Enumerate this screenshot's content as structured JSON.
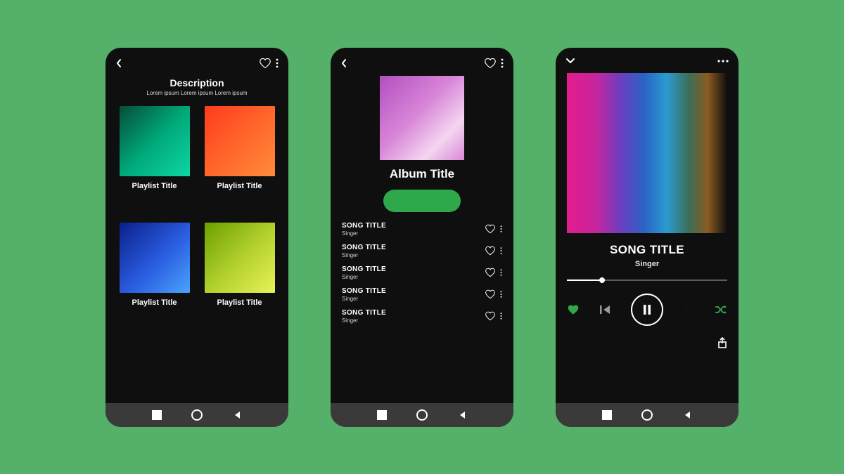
{
  "screen1": {
    "description_heading": "Description",
    "description_sub": "Lorem ipsum  Lorem ipsum  Lorem ipsum",
    "tiles": [
      {
        "label": "Playlist Title"
      },
      {
        "label": "Playlist Title"
      },
      {
        "label": "Playlist Title"
      },
      {
        "label": "Playlist Title"
      }
    ]
  },
  "screen2": {
    "album_title": "Album Title",
    "songs": [
      {
        "title": "SONG TITLE",
        "singer": "Singer"
      },
      {
        "title": "SONG TITLE",
        "singer": "Singer"
      },
      {
        "title": "SONG TITLE",
        "singer": "Singer"
      },
      {
        "title": "SONG TITLE",
        "singer": "Singer"
      },
      {
        "title": "SONG TITLE",
        "singer": "Singer"
      }
    ]
  },
  "screen3": {
    "song_title": "SONG TITLE",
    "singer": "Singer",
    "progress_percent": 22
  },
  "colors": {
    "accent_green": "#2ea84a",
    "background": "#55b169",
    "phone_bg": "#0f0f0f"
  }
}
